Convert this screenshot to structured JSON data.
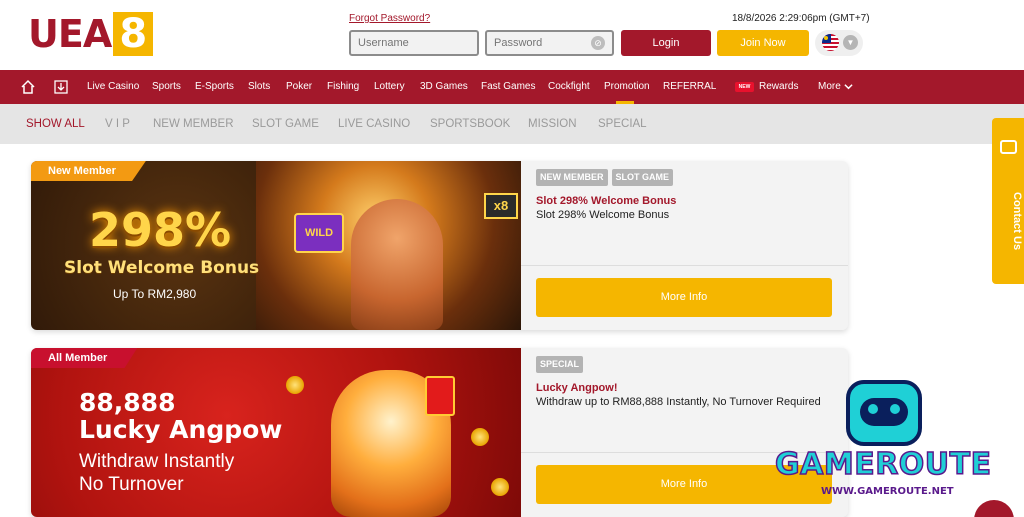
{
  "brand": {
    "logo_text": "UEA",
    "logo_num": "8",
    "primary": "#a3182b",
    "accent": "#f5b600"
  },
  "header": {
    "forgot_password": "Forgot Password?",
    "datetime": "18/8/2026 2:29:06pm (GMT+7)",
    "username_placeholder": "Username",
    "password_placeholder": "Password",
    "login_label": "Login",
    "join_label": "Join Now",
    "language_flag": "malaysia-flag-icon"
  },
  "nav": {
    "icons": [
      "home-icon",
      "download-icon"
    ],
    "items": [
      {
        "label": "Live Casino"
      },
      {
        "label": "Sports"
      },
      {
        "label": "E-Sports"
      },
      {
        "label": "Slots"
      },
      {
        "label": "Poker"
      },
      {
        "label": "Fishing"
      },
      {
        "label": "Lottery"
      },
      {
        "label": "3D Games"
      },
      {
        "label": "Fast Games"
      },
      {
        "label": "Cockfight"
      },
      {
        "label": "Promotion"
      },
      {
        "label": "REFERRAL"
      },
      {
        "label": "Rewards"
      },
      {
        "label": "More"
      }
    ],
    "new_badge": "NEW",
    "active": "Promotion"
  },
  "tabs": [
    {
      "label": "SHOW ALL"
    },
    {
      "label": "V I P"
    },
    {
      "label": "NEW MEMBER"
    },
    {
      "label": "SLOT GAME"
    },
    {
      "label": "LIVE CASINO"
    },
    {
      "label": "SPORTSBOOK"
    },
    {
      "label": "MISSION"
    },
    {
      "label": "SPECIAL"
    }
  ],
  "promos": [
    {
      "ribbon": "New Member",
      "banner_big": "298%",
      "banner_sub": "Slot Welcome Bonus",
      "banner_small": "Up To RM2,980",
      "tags": [
        "NEW MEMBER",
        "SLOT GAME"
      ],
      "title": "Slot 298% Welcome Bonus",
      "desc": "Slot 298% Welcome Bonus",
      "button": "More Info"
    },
    {
      "ribbon": "All Member",
      "banner_num": "88,888",
      "banner_title": "Lucky Angpow",
      "banner_l1": "Withdraw Instantly",
      "banner_l2": "No Turnover",
      "tags": [
        "SPECIAL"
      ],
      "title": "Lucky Angpow!",
      "desc": "Withdraw up to RM88,888 Instantly, No Turnover Required",
      "button": "More Info"
    }
  ],
  "contact": {
    "label": "Contact Us"
  },
  "watermark": {
    "name": "GAMEROUTE",
    "url": "WWW.GAMEROUTE.NET"
  }
}
